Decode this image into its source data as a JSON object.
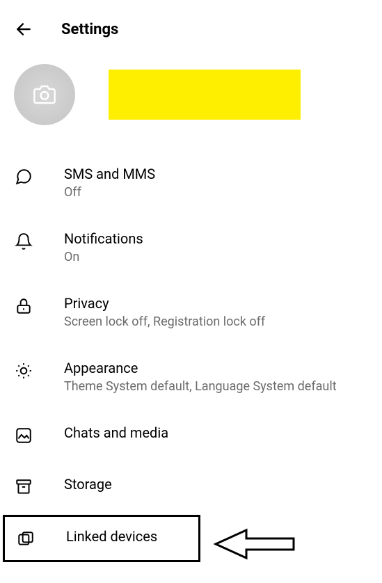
{
  "header": {
    "title": "Settings"
  },
  "settings": [
    {
      "icon": "chat-bubble",
      "title": "SMS and MMS",
      "subtitle": "Off"
    },
    {
      "icon": "bell",
      "title": "Notifications",
      "subtitle": "On"
    },
    {
      "icon": "lock",
      "title": "Privacy",
      "subtitle": "Screen lock off, Registration lock off"
    },
    {
      "icon": "sun",
      "title": "Appearance",
      "subtitle": "Theme System default, Language System default"
    },
    {
      "icon": "image",
      "title": "Chats and media",
      "subtitle": ""
    },
    {
      "icon": "archive-box",
      "title": "Storage",
      "subtitle": ""
    },
    {
      "icon": "devices",
      "title": "Linked devices",
      "subtitle": ""
    }
  ]
}
